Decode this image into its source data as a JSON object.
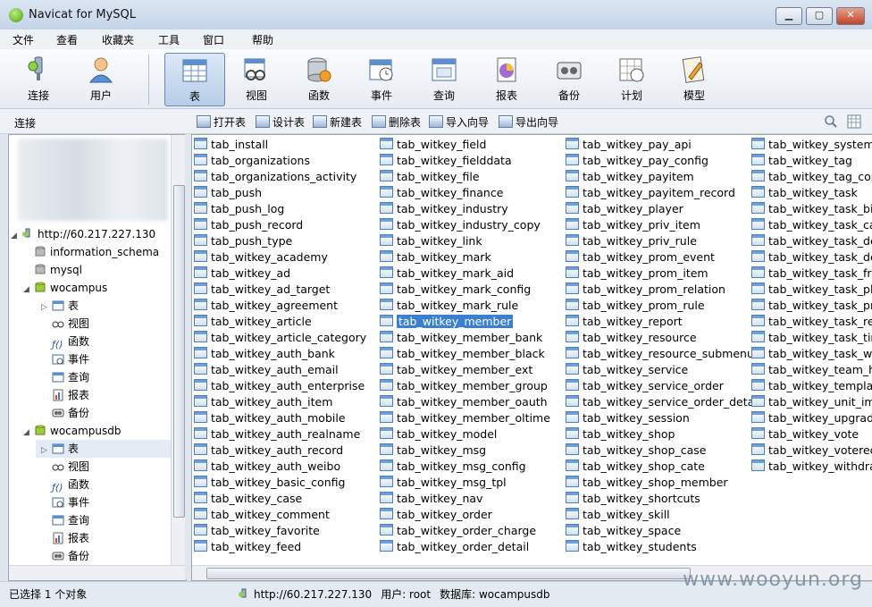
{
  "window": {
    "title": "Navicat for MySQL"
  },
  "menu": [
    "文件",
    "查看",
    "收藏夹",
    "工具",
    "窗口",
    "帮助"
  ],
  "toolbar": {
    "items": [
      {
        "label": "连接",
        "icon": "connection-icon"
      },
      {
        "label": "用户",
        "icon": "user-icon"
      },
      {
        "label": "表",
        "icon": "table-icon",
        "active": true
      },
      {
        "label": "视图",
        "icon": "view-icon"
      },
      {
        "label": "函数",
        "icon": "function-icon"
      },
      {
        "label": "事件",
        "icon": "event-icon"
      },
      {
        "label": "查询",
        "icon": "query-icon"
      },
      {
        "label": "报表",
        "icon": "report-icon"
      },
      {
        "label": "备份",
        "icon": "backup-icon"
      },
      {
        "label": "计划",
        "icon": "schedule-icon"
      },
      {
        "label": "模型",
        "icon": "model-icon"
      }
    ]
  },
  "subtoolbar": {
    "connection_label": "连接",
    "buttons": [
      "打开表",
      "设计表",
      "新建表",
      "删除表",
      "导入向导",
      "导出向导"
    ]
  },
  "tree": {
    "connection": "http://60.217.227.130",
    "databases": [
      "information_schema",
      "mysql"
    ],
    "db1": {
      "name": "wocampus",
      "children": [
        "表",
        "视图",
        "函数",
        "事件",
        "查询",
        "报表",
        "备份"
      ]
    },
    "db2": {
      "name": "wocampusdb",
      "children": [
        "表",
        "视图",
        "函数",
        "事件",
        "查询",
        "报表",
        "备份"
      ]
    }
  },
  "tables": {
    "selected": "tab_witkey_member",
    "columns": [
      [
        "tab_install",
        "tab_organizations",
        "tab_organizations_activity",
        "tab_push",
        "tab_push_log",
        "tab_push_record",
        "tab_push_type",
        "tab_witkey_academy",
        "tab_witkey_ad",
        "tab_witkey_ad_target",
        "tab_witkey_agreement",
        "tab_witkey_article",
        "tab_witkey_article_category",
        "tab_witkey_auth_bank",
        "tab_witkey_auth_email",
        "tab_witkey_auth_enterprise",
        "tab_witkey_auth_item",
        "tab_witkey_auth_mobile",
        "tab_witkey_auth_realname",
        "tab_witkey_auth_record",
        "tab_witkey_auth_weibo",
        "tab_witkey_basic_config",
        "tab_witkey_case",
        "tab_witkey_comment",
        "tab_witkey_favorite",
        "tab_witkey_feed"
      ],
      [
        "tab_witkey_field",
        "tab_witkey_fielddata",
        "tab_witkey_file",
        "tab_witkey_finance",
        "tab_witkey_industry",
        "tab_witkey_industry_copy",
        "tab_witkey_link",
        "tab_witkey_mark",
        "tab_witkey_mark_aid",
        "tab_witkey_mark_config",
        "tab_witkey_mark_rule",
        "tab_witkey_member",
        "tab_witkey_member_bank",
        "tab_witkey_member_black",
        "tab_witkey_member_ext",
        "tab_witkey_member_group",
        "tab_witkey_member_oauth",
        "tab_witkey_member_oltime",
        "tab_witkey_model",
        "tab_witkey_msg",
        "tab_witkey_msg_config",
        "tab_witkey_msg_tpl",
        "tab_witkey_nav",
        "tab_witkey_order",
        "tab_witkey_order_charge",
        "tab_witkey_order_detail"
      ],
      [
        "tab_witkey_pay_api",
        "tab_witkey_pay_config",
        "tab_witkey_payitem",
        "tab_witkey_payitem_record",
        "tab_witkey_player",
        "tab_witkey_priv_item",
        "tab_witkey_priv_rule",
        "tab_witkey_prom_event",
        "tab_witkey_prom_item",
        "tab_witkey_prom_relation",
        "tab_witkey_prom_rule",
        "tab_witkey_report",
        "tab_witkey_resource",
        "tab_witkey_resource_submenu",
        "tab_witkey_service",
        "tab_witkey_service_order",
        "tab_witkey_service_order_detail",
        "tab_witkey_session",
        "tab_witkey_shop",
        "tab_witkey_shop_case",
        "tab_witkey_shop_cate",
        "tab_witkey_shop_member",
        "tab_witkey_shortcuts",
        "tab_witkey_skill",
        "tab_witkey_space",
        "tab_witkey_students"
      ],
      [
        "tab_witkey_system_",
        "tab_witkey_tag",
        "tab_witkey_tag_cop",
        "tab_witkey_task",
        "tab_witkey_task_bic",
        "tab_witkey_task_ca",
        "tab_witkey_task_de",
        "tab_witkey_task_de",
        "tab_witkey_task_frc",
        "tab_witkey_task_pla",
        "tab_witkey_task_pr",
        "tab_witkey_task_rel",
        "tab_witkey_task_tim",
        "tab_witkey_task_wc",
        "tab_witkey_team_hi",
        "tab_witkey_templat",
        "tab_witkey_unit_ima",
        "tab_witkey_upgrad",
        "tab_witkey_vote",
        "tab_witkey_voterec",
        "tab_witkey_withdra"
      ]
    ]
  },
  "status": {
    "selection": "已选择 1 个对象",
    "host": "http://60.217.227.130",
    "user": "用户: root",
    "database": "数据库: wocampusdb"
  },
  "watermark": "www.wooyun.org"
}
